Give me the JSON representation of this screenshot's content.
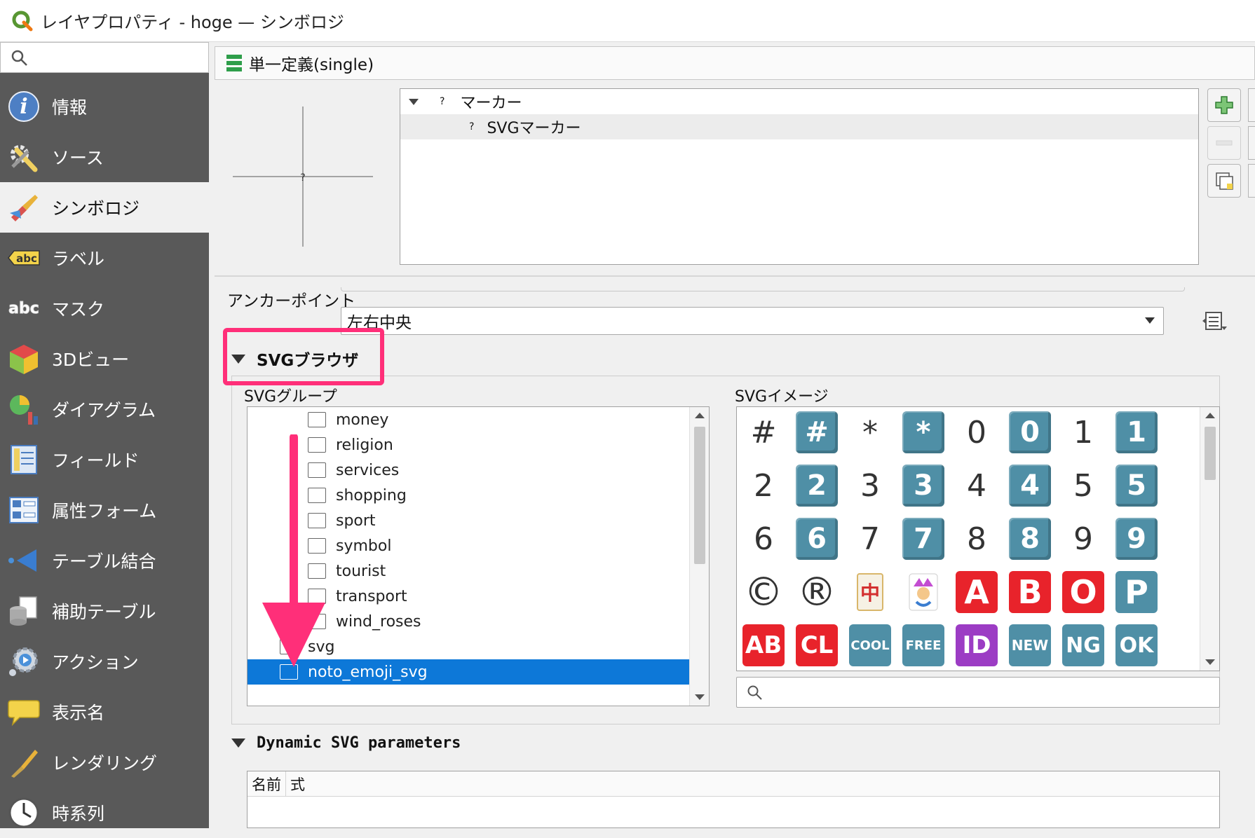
{
  "window": {
    "title": "レイヤプロパティ - hoge — シンボロジ"
  },
  "sidebar": {
    "search_placeholder": "",
    "items": [
      {
        "label": "情報",
        "icon": "info-icon"
      },
      {
        "label": "ソース",
        "icon": "source-tools-icon"
      },
      {
        "label": "シンボロジ",
        "icon": "symbology-brush-icon",
        "active": true
      },
      {
        "label": "ラベル",
        "icon": "label-abc-icon"
      },
      {
        "label": "マスク",
        "icon": "mask-abc-icon"
      },
      {
        "label": "3Dビュー",
        "icon": "3d-cube-icon"
      },
      {
        "label": "ダイアグラム",
        "icon": "diagram-icon"
      },
      {
        "label": "フィールド",
        "icon": "fields-icon"
      },
      {
        "label": "属性フォーム",
        "icon": "attribute-form-icon"
      },
      {
        "label": "テーブル結合",
        "icon": "join-icon"
      },
      {
        "label": "補助テーブル",
        "icon": "auxiliary-storage-icon"
      },
      {
        "label": "アクション",
        "icon": "action-gear-icon"
      },
      {
        "label": "表示名",
        "icon": "display-speech-icon"
      },
      {
        "label": "レンダリング",
        "icon": "rendering-brush-icon"
      },
      {
        "label": "時系列",
        "icon": "temporal-clock-icon"
      }
    ]
  },
  "renderer": {
    "label": "単一定義(single)"
  },
  "symbol_tree": {
    "rows": [
      {
        "label": "マーカー",
        "marker": "?",
        "expanded": true
      },
      {
        "label": "SVGマーカー",
        "marker": "?",
        "selected": true
      }
    ]
  },
  "anchor": {
    "label": "アンカーポイント",
    "value": "左右中央"
  },
  "svg_browser": {
    "title": "SVGブラウザ",
    "group_label": "SVGグループ",
    "image_label": "SVGイメージ",
    "groups": [
      "money",
      "religion",
      "services",
      "shopping",
      "sport",
      "symbol",
      "tourist",
      "transport",
      "wind_roses"
    ],
    "root_groups": [
      {
        "label": "svg",
        "selected": false
      },
      {
        "label": "noto_emoji_svg",
        "selected": true
      }
    ],
    "images": [
      [
        "#",
        "#",
        "*",
        "*",
        "0",
        "0",
        "1",
        "1"
      ],
      [
        "2",
        "2",
        "3",
        "3",
        "4",
        "4",
        "5",
        "5"
      ],
      [
        "6",
        "6",
        "7",
        "7",
        "8",
        "8",
        "9",
        "9"
      ],
      [
        "©",
        "®",
        "中",
        "🃏",
        "A",
        "B",
        "O",
        "P"
      ],
      [
        "AB",
        "CL",
        "COOL",
        "FREE",
        "ID",
        "NEW",
        "NG",
        "OK"
      ]
    ],
    "image_search_placeholder": ""
  },
  "dynamic": {
    "title": "Dynamic SVG parameters",
    "col_name": "名前",
    "col_expr": "式"
  },
  "colors": {
    "accent_highlight": "#ff2f79",
    "selection": "#0d78d8",
    "sidebar_bg": "#595959",
    "keycap": "#4f8fa6"
  }
}
